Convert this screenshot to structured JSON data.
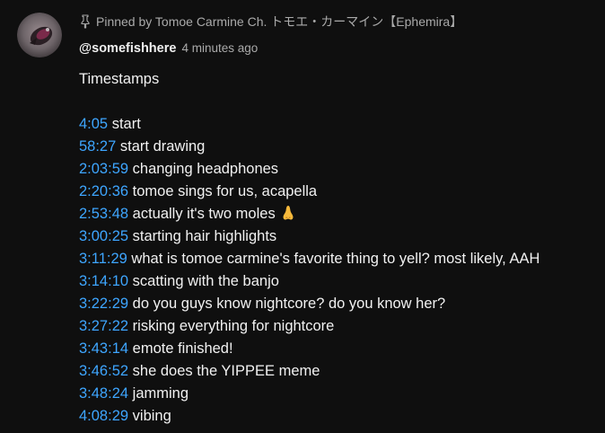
{
  "pinned": {
    "text": "Pinned by Tomoe Carmine Ch. トモエ・カーマイン【Ephemira】",
    "icon": "pin-icon"
  },
  "comment": {
    "author": "@somefishhere",
    "time": "4 minutes ago",
    "heading": "Timestamps",
    "timestamps": [
      {
        "time": "4:05",
        "text": "start"
      },
      {
        "time": "58:27",
        "text": "start drawing"
      },
      {
        "time": "2:03:59",
        "text": "changing headphones"
      },
      {
        "time": "2:20:36",
        "text": "tomoe sings for us, acapella"
      },
      {
        "time": "2:53:48",
        "text": "actually it's two moles",
        "emoji": "nose-emoji"
      },
      {
        "time": "3:00:25",
        "text": "starting hair highlights"
      },
      {
        "time": "3:11:29",
        "text": "what is tomoe carmine's favorite thing to yell? most likely, AAH"
      },
      {
        "time": "3:14:10",
        "text": "scatting with the banjo"
      },
      {
        "time": "3:22:29",
        "text": "do you guys know nightcore? do you know her?"
      },
      {
        "time": "3:27:22",
        "text": "risking everything for nightcore"
      },
      {
        "time": "3:43:14",
        "text": "emote finished!"
      },
      {
        "time": "3:46:52",
        "text": "she does the YIPPEE meme"
      },
      {
        "time": "3:48:24",
        "text": "jamming"
      },
      {
        "time": "4:08:29",
        "text": "vibing"
      }
    ]
  },
  "colors": {
    "background": "#0f0f0f",
    "text": "#f1f1f1",
    "secondary": "#aaaaaa",
    "link": "#3ea6ff"
  }
}
